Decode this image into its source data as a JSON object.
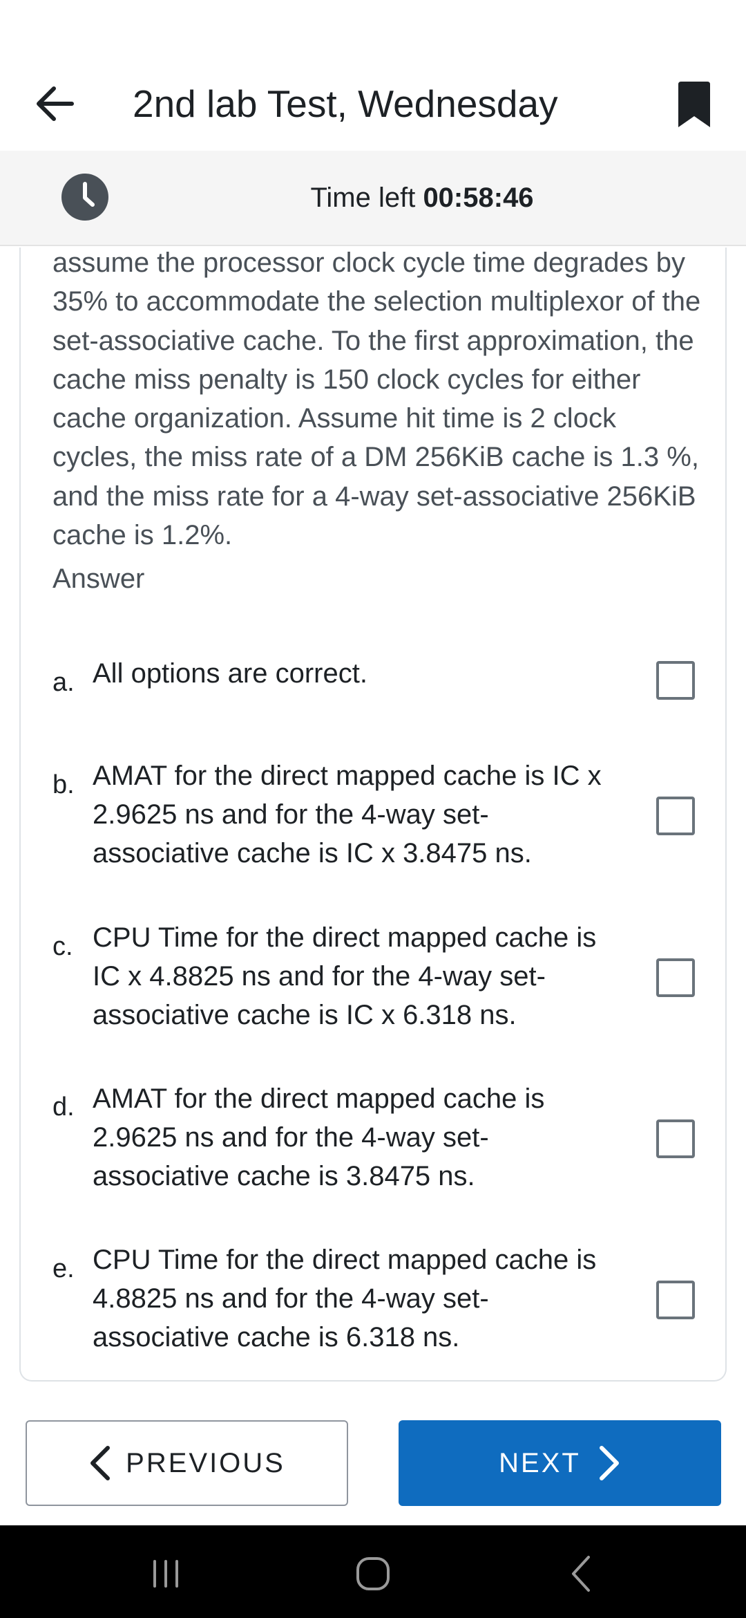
{
  "header": {
    "title": "2nd lab Test, Wednesday"
  },
  "timer": {
    "label": "Time left",
    "value": "00:58:46"
  },
  "question": {
    "text": "assume the processor clock cycle time degrades by 35% to accommodate the selection multiplexor of the set-associative cache. To the first approximation, the cache miss penalty is 150 clock cycles for either cache organization. Assume hit time is 2 clock cycles, the miss rate of a DM 256KiB cache is 1.3 %, and the miss rate for a 4-way set-associative 256KiB cache is 1.2%.",
    "answer_label": "Answer"
  },
  "options": [
    {
      "letter": "a.",
      "text": "All options are correct.",
      "checked": false
    },
    {
      "letter": "b.",
      "text": "AMAT for the direct mapped cache is IC x 2.9625 ns and for the 4-way set-associative cache is IC x 3.8475 ns.",
      "checked": false
    },
    {
      "letter": "c.",
      "text": "CPU Time for the direct mapped cache is IC x 4.8825 ns and for the 4-way set-associative cache is IC x 6.318 ns.",
      "checked": false
    },
    {
      "letter": "d.",
      "text": "AMAT for the direct mapped cache is 2.9625 ns and for the 4-way set-associative cache is 3.8475 ns.",
      "checked": false
    },
    {
      "letter": "e.",
      "text": "CPU Time for the direct mapped cache is 4.8825 ns and for the 4-way set-associative cache is 6.318 ns.",
      "checked": false
    }
  ],
  "navigation": {
    "previous_label": "PREVIOUS",
    "next_label": "NEXT"
  },
  "colors": {
    "accent": "#0f6cbf",
    "text": "#1d2125",
    "muted_text": "#495057",
    "timer_bar": "#f5f5f5"
  },
  "icons": {
    "back": "arrow-left-icon",
    "bookmark": "bookmark-icon",
    "clock": "clock-icon",
    "prev": "chevron-left-icon",
    "next": "chevron-right-icon",
    "system_recents": "recents-icon",
    "system_home": "home-icon",
    "system_back": "system-back-icon"
  }
}
